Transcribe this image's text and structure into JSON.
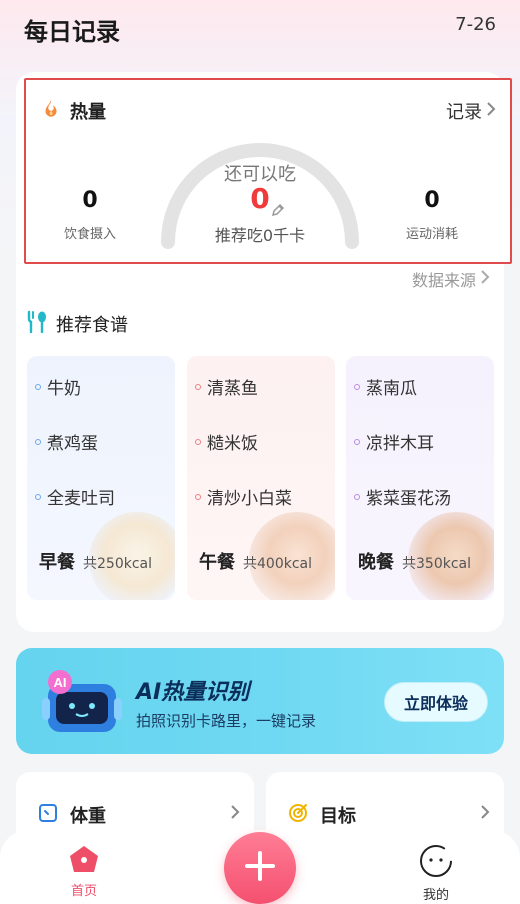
{
  "header": {
    "title": "每日记录",
    "date": "7-26"
  },
  "calorie": {
    "title": "热量",
    "record_link": "记录",
    "intake_value": "0",
    "intake_label": "饮食摄入",
    "remain_label": "还可以吃",
    "remain_value": "0",
    "suggest_text": "推荐吃0千卡",
    "burn_value": "0",
    "burn_label": "运动消耗",
    "data_source": "数据来源"
  },
  "recipes": {
    "title": "推荐食谱",
    "meals": [
      {
        "name": "早餐",
        "kcal": "共250kcal",
        "items": [
          "牛奶",
          "煮鸡蛋",
          "全麦吐司"
        ]
      },
      {
        "name": "午餐",
        "kcal": "共400kcal",
        "items": [
          "清蒸鱼",
          "糙米饭",
          "清炒小白菜"
        ]
      },
      {
        "name": "晚餐",
        "kcal": "共350kcal",
        "items": [
          "蒸南瓜",
          "凉拌木耳",
          "紫菜蛋花汤"
        ]
      }
    ]
  },
  "ai_banner": {
    "title": "AI热量识别",
    "subtitle": "拍照识别卡路里，一键记录",
    "button": "立即体验",
    "badge": "AI"
  },
  "cards": {
    "weight": "体重",
    "goal": "目标"
  },
  "tabbar": {
    "home": "首页",
    "mine": "我的"
  },
  "colors": {
    "accent": "#ee4e68",
    "highlight_border": "#e04b4b",
    "banner": "#6fd8f2"
  }
}
